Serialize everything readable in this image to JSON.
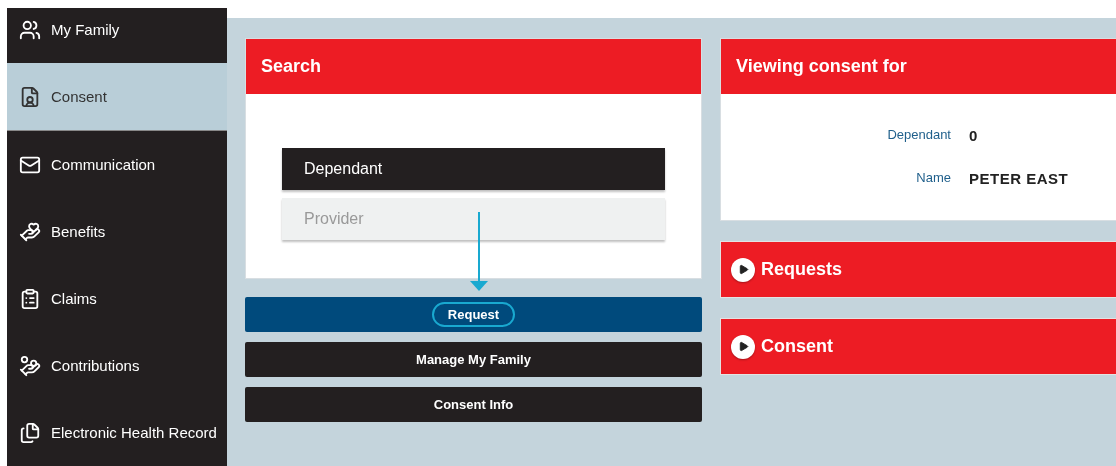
{
  "sidebar": {
    "items": [
      {
        "label": "My Family",
        "selected": false
      },
      {
        "label": "Consent",
        "selected": true
      },
      {
        "label": "Communication",
        "selected": false
      },
      {
        "label": "Benefits",
        "selected": false
      },
      {
        "label": "Claims",
        "selected": false
      },
      {
        "label": "Contributions",
        "selected": false
      },
      {
        "label": "Electronic Health Record",
        "selected": false
      }
    ]
  },
  "search": {
    "title": "Search",
    "options": [
      {
        "label": "Dependant",
        "selected": true
      },
      {
        "label": "Provider",
        "selected": false
      }
    ]
  },
  "buttons": [
    {
      "label": "Request",
      "kind": "primary",
      "highlighted": true
    },
    {
      "label": "Manage My Family",
      "kind": "dark",
      "highlighted": false
    },
    {
      "label": "Consent Info",
      "kind": "dark",
      "highlighted": false
    }
  ],
  "viewing": {
    "title": "Viewing consent for",
    "fields": [
      {
        "label": "Dependant",
        "value": "0"
      },
      {
        "label": "Name",
        "value": "PETER EAST"
      }
    ]
  },
  "sections": [
    {
      "title": "Requests",
      "expanded": false
    },
    {
      "title": "Consent",
      "expanded": false
    }
  ]
}
